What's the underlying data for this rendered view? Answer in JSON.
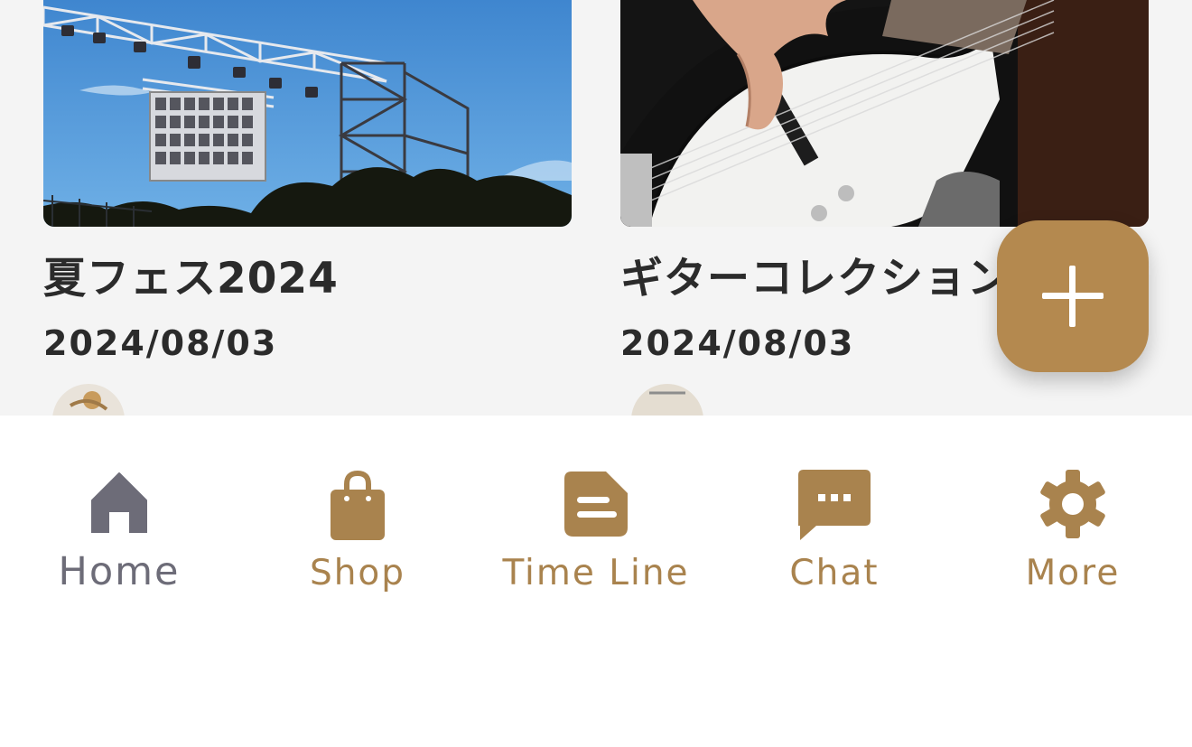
{
  "posts": [
    {
      "title": "夏フェス2024",
      "date": "2024/08/03",
      "image": "festival-stage-photo"
    },
    {
      "title": "ギターコレクション",
      "date": "2024/08/03",
      "image": "bass-guitar-photo"
    }
  ],
  "fab": {
    "icon": "plus-icon"
  },
  "tabs": [
    {
      "label": "Home",
      "icon": "home-icon",
      "active": true
    },
    {
      "label": "Shop",
      "icon": "shopping-bag-icon"
    },
    {
      "label": "Time Line",
      "icon": "document-icon"
    },
    {
      "label": "Chat",
      "icon": "chat-bubble-icon"
    },
    {
      "label": "More",
      "icon": "gear-icon"
    }
  ],
  "colors": {
    "accent": "#b4894f",
    "tab_icon": "#a9834e",
    "active_tab": "#6d6c78",
    "background": "#f4f4f4",
    "text": "#2b2b2b"
  }
}
